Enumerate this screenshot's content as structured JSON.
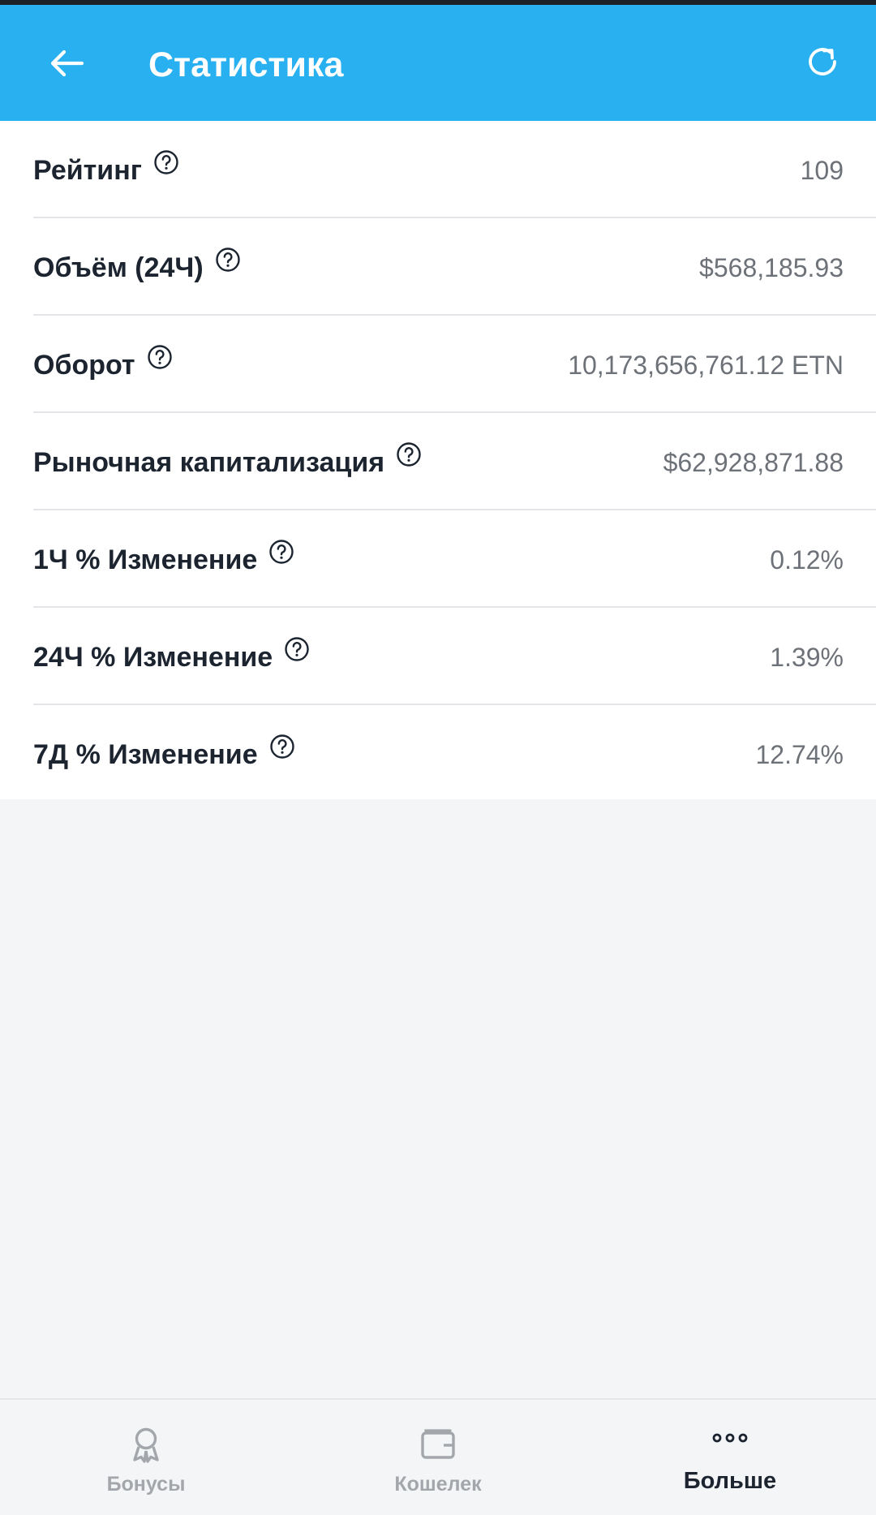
{
  "header": {
    "title": "Статистика",
    "back_icon": "arrow-left-icon",
    "refresh_icon": "refresh-icon",
    "background_color": "#29b0f0"
  },
  "stats": [
    {
      "label": "Рейтинг",
      "value": "109"
    },
    {
      "label": "Объём (24Ч)",
      "value": "$568,185.93"
    },
    {
      "label": "Оборот",
      "value": "10,173,656,761.12 ETN"
    },
    {
      "label": "Рыночная капитализация",
      "value": "$62,928,871.88"
    },
    {
      "label": "1Ч % Изменение",
      "value": "0.12%"
    },
    {
      "label": "24Ч % Изменение",
      "value": "1.39%"
    },
    {
      "label": "7Д % Изменение",
      "value": "12.74%"
    }
  ],
  "help_icon": "question-circle-icon",
  "bottom_nav": {
    "items": [
      {
        "label": "Бонусы",
        "icon": "award-ribbon-icon",
        "active": false
      },
      {
        "label": "Кошелек",
        "icon": "wallet-icon",
        "active": false
      },
      {
        "label": "Больше",
        "icon": "more-dots-icon",
        "active": true
      }
    ]
  }
}
